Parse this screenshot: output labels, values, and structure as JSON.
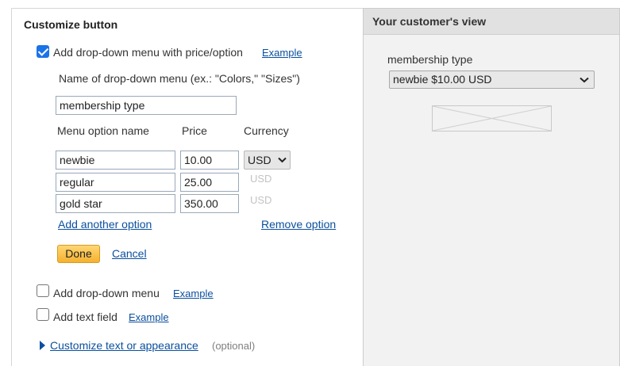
{
  "left": {
    "title": "Customize button",
    "dropdown_price": {
      "checkbox_label": "Add drop-down menu with price/option",
      "example_link": "Example",
      "name_label": "Name of drop-down menu (ex.: \"Colors,\" \"Sizes\")",
      "name_value": "membership type",
      "col_option": "Menu option name",
      "col_price": "Price",
      "col_currency": "Currency",
      "options": [
        {
          "name": "newbie",
          "price": "10.00",
          "currency": "USD"
        },
        {
          "name": "regular",
          "price": "25.00",
          "currency": "USD"
        },
        {
          "name": "gold star",
          "price": "350.00",
          "currency": "USD"
        }
      ],
      "add_option": "Add another option",
      "remove_option": "Remove option",
      "done": "Done",
      "cancel": "Cancel"
    },
    "dropdown_menu": {
      "label": "Add drop-down menu",
      "example_link": "Example"
    },
    "text_field": {
      "label": "Add text field",
      "example_link": "Example"
    },
    "customize": {
      "link": "Customize text or appearance",
      "optional": "(optional)"
    }
  },
  "right": {
    "title": "Your customer's view",
    "preview_label": "membership type",
    "preview_select_value": "newbie $10.00 USD"
  },
  "colors": {
    "link": "#0b4f9e",
    "checkbox_checked": "#1a73e8",
    "done_button": "#f5b12e",
    "right_panel_bg": "#f2f2f2"
  },
  "icons": [
    "checkmark-icon",
    "chevron-down-icon",
    "triangle-right-icon",
    "image-placeholder-icon"
  ]
}
